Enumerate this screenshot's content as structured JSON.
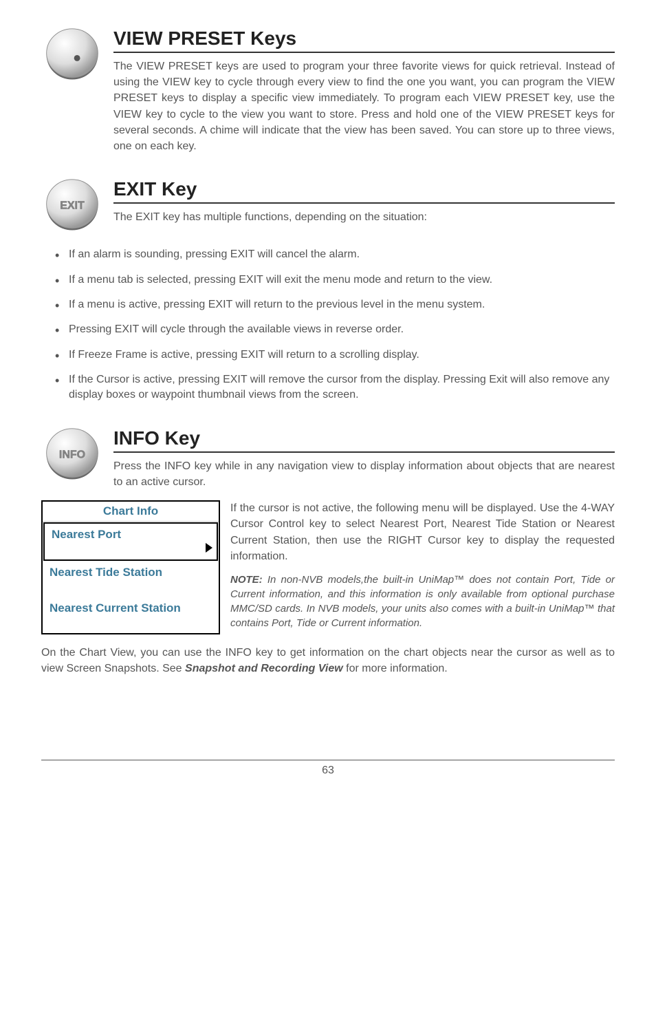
{
  "section1": {
    "title": "VIEW PRESET Keys",
    "body": "The VIEW PRESET keys are used to program your three favorite views for quick retrieval. Instead of using the VIEW key to cycle through every view to find the one you want, you can program the VIEW PRESET keys to display a specific view immediately. To program each VIEW PRESET key, use the VIEW key to cycle to the view you want to store. Press and hold one of the VIEW PRESET keys for several seconds. A chime will indicate that the view has been saved. You can store up to three views, one on each key."
  },
  "section2": {
    "title": "EXIT Key",
    "intro": "The EXIT key has multiple functions, depending on the situation:",
    "bullets": [
      "If an alarm is sounding, pressing EXIT will cancel the alarm.",
      "If a menu tab is selected, pressing EXIT will exit the menu mode and return to the view.",
      "If a menu is active, pressing EXIT will return to the previous level in the menu system.",
      "Pressing EXIT will cycle through the available views in reverse order.",
      "If Freeze Frame is active, pressing EXIT will return to a scrolling display.",
      "If the Cursor is active, pressing EXIT will remove the cursor from the display. Pressing Exit will also remove any display boxes or waypoint thumbnail views from the screen."
    ]
  },
  "section3": {
    "title": "INFO Key",
    "intro": "Press the INFO key while in any navigation view to display information about objects that are nearest to an active cursor.",
    "chartBox": {
      "title": "Chart Info",
      "items": [
        "Nearest Port",
        "Nearest Tide Station",
        "Nearest Current Station"
      ]
    },
    "rightPara": "If the cursor is not active, the following menu will be displayed. Use the 4-WAY Cursor Control key to select Nearest Port, Nearest Tide Station or Nearest Current Station, then use the RIGHT Cursor key to display the requested information.",
    "noteLabel": "NOTE:",
    "noteBody": " In non-NVB models,the built-in UniMap™ does not contain Port, Tide or Current information, and this information is only available from optional purchase MMC/SD cards. In NVB models, your units also comes with a built-in UniMap™ that contains Port, Tide or Current information.",
    "bottom1": "On the Chart View, you can use the INFO key to get information on the chart objects near the cursor as well as to view Screen Snapshots. See ",
    "bottomRef": "Snapshot and Recording View",
    "bottom2": " for more information."
  },
  "pageNumber": "63",
  "buttonLabels": {
    "exit": "EXIT",
    "info": "INFO"
  }
}
